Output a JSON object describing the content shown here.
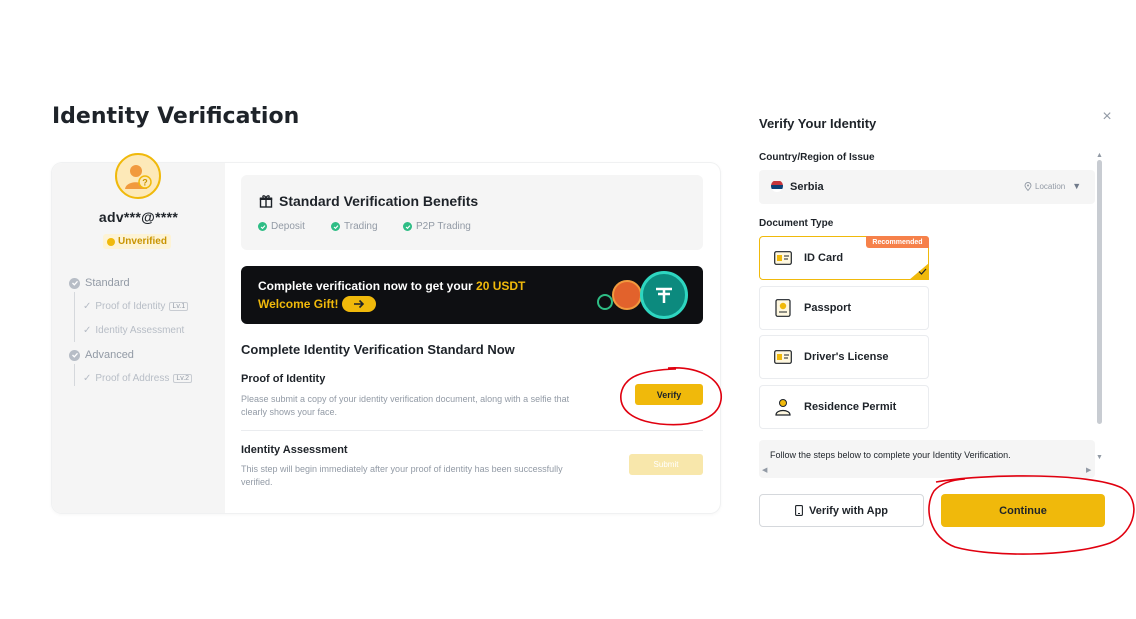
{
  "page": {
    "title": "Identity Verification"
  },
  "sidebar": {
    "account": "adv***@****",
    "status": "Unverified",
    "levels": [
      {
        "label": "Standard",
        "items": [
          {
            "label": "Proof of Identity",
            "badge": "Lv.1"
          },
          {
            "label": "Identity Assessment",
            "badge": ""
          }
        ]
      },
      {
        "label": "Advanced",
        "items": [
          {
            "label": "Proof of Address",
            "badge": "Lv.2"
          }
        ]
      }
    ]
  },
  "benefits": {
    "title": "Standard Verification Benefits",
    "items": [
      "Deposit",
      "Trading",
      "P2P Trading"
    ]
  },
  "banner": {
    "line1_prefix": "Complete verification now to get your ",
    "line1_highlight": "20 USDT",
    "line2": "Welcome Gift!"
  },
  "steps": {
    "section_title": "Complete Identity Verification Standard Now",
    "proof": {
      "title": "Proof of Identity",
      "desc": "Please submit a copy of your identity verification document, along with a selfie that clearly shows your face.",
      "button": "Verify"
    },
    "assessment": {
      "title": "Identity Assessment",
      "desc": "This step will begin immediately after your proof of identity has been successfully verified.",
      "button": "Submit"
    }
  },
  "modal": {
    "title": "Verify Your Identity",
    "close": "×",
    "country_label": "Country/Region of Issue",
    "country": "Serbia",
    "location": "Location",
    "doc_type_label": "Document Type",
    "recommended": "Recommended",
    "documents": [
      "ID Card",
      "Passport",
      "Driver's License",
      "Residence Permit"
    ],
    "info": "Follow the steps below to complete your Identity Verification.",
    "app_button": "Verify with App",
    "continue_button": "Continue"
  },
  "colors": {
    "accent": "#f0b90b",
    "success": "#2ebd85",
    "annotation": "#e0000f"
  }
}
